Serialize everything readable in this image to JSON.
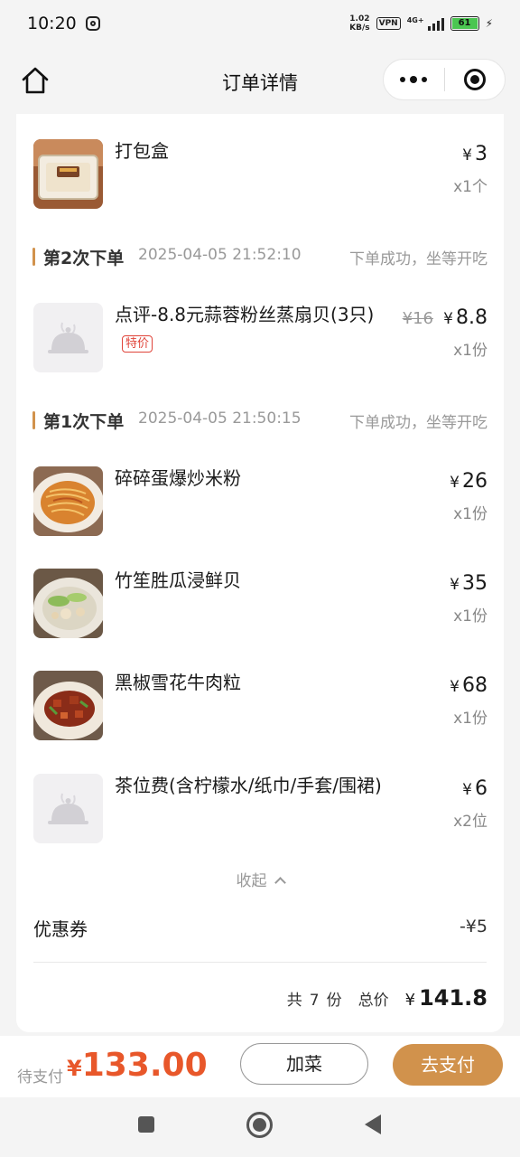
{
  "status_bar": {
    "time": "10:20",
    "net_speed_value": "1.02",
    "net_speed_unit": "KB/s",
    "vpn": "VPN",
    "network": "4G+",
    "battery": "61"
  },
  "header": {
    "title": "订单详情"
  },
  "batches": [
    {
      "title": "第2次下单",
      "time": "2025-04-05 21:52:10",
      "status": "下单成功，坐等开吃"
    },
    {
      "title": "第1次下单",
      "time": "2025-04-05 21:50:15",
      "status": "下单成功，坐等开吃"
    }
  ],
  "items": [
    {
      "name": "打包盒",
      "currency": "¥",
      "price": "3",
      "qty": "x1个"
    },
    {
      "name": "点评-8.8元蒜蓉粉丝蒸扇贝(3只)",
      "tag": "特价",
      "currency": "¥",
      "old_price": "¥16",
      "price": "8.8",
      "qty": "x1份"
    },
    {
      "name": "碎碎蛋爆炒米粉",
      "currency": "¥",
      "price": "26",
      "qty": "x1份"
    },
    {
      "name": "竹笙胜瓜浸鲜贝",
      "currency": "¥",
      "price": "35",
      "qty": "x1份"
    },
    {
      "name": "黑椒雪花牛肉粒",
      "currency": "¥",
      "price": "68",
      "qty": "x1份"
    },
    {
      "name": "茶位费(含柠檬水/纸巾/手套/围裙)",
      "currency": "¥",
      "price": "6",
      "qty": "x2位"
    }
  ],
  "collapse_label": "收起",
  "coupon": {
    "label": "优惠券",
    "value": "-¥5"
  },
  "summary": {
    "count_prefix": "共",
    "count": "7",
    "count_suffix": "份",
    "total_label": "总价",
    "currency": "¥",
    "total": "141.8"
  },
  "pay_bar": {
    "label": "待支付",
    "currency": "¥",
    "amount": "133.00",
    "add_label": "加菜",
    "pay_label": "去支付"
  },
  "colors": {
    "accent": "#d1924c",
    "price_highlight": "#e8572a",
    "tag_red": "#e0443a"
  }
}
